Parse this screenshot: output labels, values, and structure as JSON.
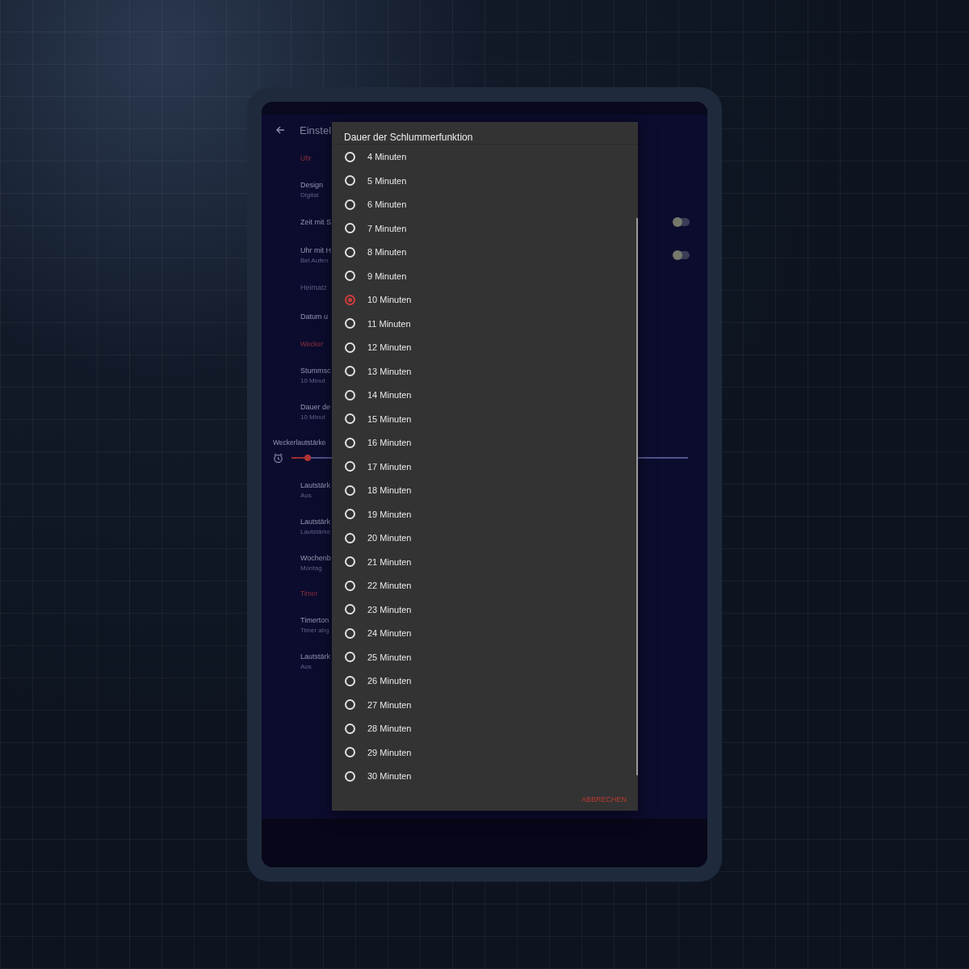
{
  "app_bar": {
    "title": "Einstel"
  },
  "settings": [
    {
      "kind": "section",
      "title": "Uhr",
      "disabled": false
    },
    {
      "kind": "item",
      "title": "Design",
      "subtitle": "Digital",
      "disabled": false
    },
    {
      "kind": "toggle",
      "title": "Zeit mit S",
      "on": false,
      "disabled": false
    },
    {
      "kind": "toggle",
      "title": "Uhr mit H",
      "subtitle": "Bei Aufen",
      "on": false,
      "disabled": false
    },
    {
      "kind": "item",
      "title": "Heimatz",
      "disabled": true
    },
    {
      "kind": "item",
      "title": "Datum u",
      "disabled": false
    },
    {
      "kind": "section",
      "title": "Wecker",
      "disabled": false
    },
    {
      "kind": "item",
      "title": "Stummsc",
      "subtitle": "10 Minut",
      "disabled": false
    },
    {
      "kind": "item",
      "title": "Dauer de",
      "subtitle": "10 Minut",
      "disabled": false
    },
    {
      "kind": "slider",
      "title": "Weckerlautstärke",
      "level": 0.04,
      "disabled": false
    },
    {
      "kind": "item",
      "title": "Lautstärk",
      "subtitle": "Aus",
      "disabled": false
    },
    {
      "kind": "item",
      "title": "Lautstärk",
      "subtitle": "Lautstärke",
      "disabled": false
    },
    {
      "kind": "item",
      "title": "Wochenb",
      "subtitle": "Montag",
      "disabled": false
    },
    {
      "kind": "section",
      "title": "Timer",
      "disabled": false
    },
    {
      "kind": "item",
      "title": "Timerton",
      "subtitle": "Timer abg",
      "disabled": false
    },
    {
      "kind": "item",
      "title": "Lautstärk",
      "subtitle": "Aus",
      "disabled": false
    }
  ],
  "dialog": {
    "title": "Dauer der Schlummerfunktion",
    "options": [
      {
        "label": "4 Minuten",
        "selected": false
      },
      {
        "label": "5 Minuten",
        "selected": false
      },
      {
        "label": "6 Minuten",
        "selected": false
      },
      {
        "label": "7 Minuten",
        "selected": false
      },
      {
        "label": "8 Minuten",
        "selected": false
      },
      {
        "label": "9 Minuten",
        "selected": false
      },
      {
        "label": "10 Minuten",
        "selected": true
      },
      {
        "label": "11 Minuten",
        "selected": false
      },
      {
        "label": "12 Minuten",
        "selected": false
      },
      {
        "label": "13 Minuten",
        "selected": false
      },
      {
        "label": "14 Minuten",
        "selected": false
      },
      {
        "label": "15 Minuten",
        "selected": false
      },
      {
        "label": "16 Minuten",
        "selected": false
      },
      {
        "label": "17 Minuten",
        "selected": false
      },
      {
        "label": "18 Minuten",
        "selected": false
      },
      {
        "label": "19 Minuten",
        "selected": false
      },
      {
        "label": "20 Minuten",
        "selected": false
      },
      {
        "label": "21 Minuten",
        "selected": false
      },
      {
        "label": "22 Minuten",
        "selected": false
      },
      {
        "label": "23 Minuten",
        "selected": false
      },
      {
        "label": "24 Minuten",
        "selected": false
      },
      {
        "label": "25 Minuten",
        "selected": false
      },
      {
        "label": "26 Minuten",
        "selected": false
      },
      {
        "label": "27 Minuten",
        "selected": false
      },
      {
        "label": "28 Minuten",
        "selected": false
      },
      {
        "label": "29 Minuten",
        "selected": false
      },
      {
        "label": "30 Minuten",
        "selected": false
      }
    ],
    "cancel": "ABBRECHEN"
  }
}
